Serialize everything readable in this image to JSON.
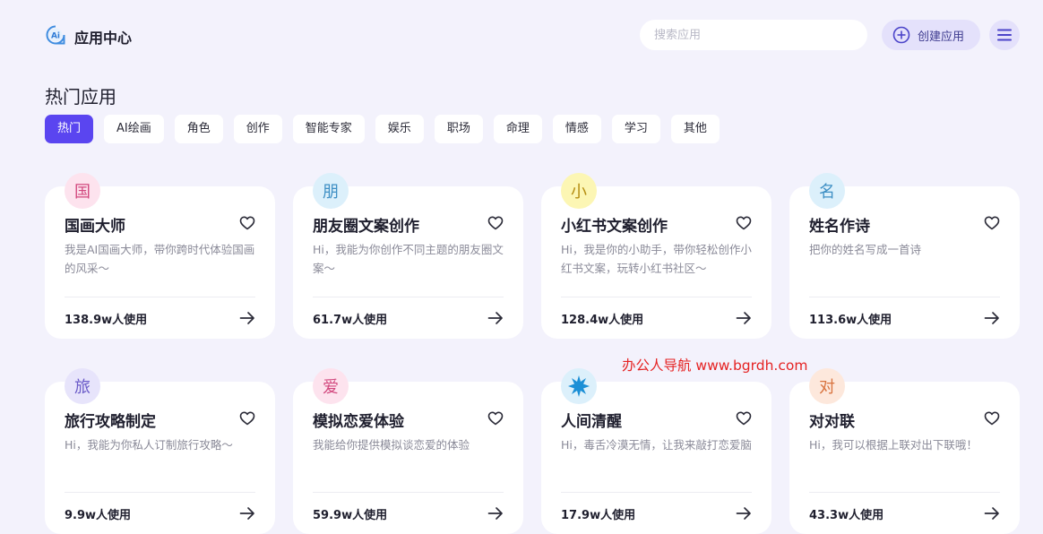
{
  "header": {
    "title": "应用中心",
    "logo_text": "Ai",
    "search_placeholder": "搜索应用",
    "create_label": "创建应用"
  },
  "section_title": "热门应用",
  "tabs": [
    {
      "label": "热门",
      "active": true
    },
    {
      "label": "AI绘画"
    },
    {
      "label": "角色"
    },
    {
      "label": "创作"
    },
    {
      "label": "智能专家"
    },
    {
      "label": "娱乐"
    },
    {
      "label": "职场"
    },
    {
      "label": "命理"
    },
    {
      "label": "情感"
    },
    {
      "label": "学习"
    },
    {
      "label": "其他"
    }
  ],
  "cards": [
    {
      "badge": "国",
      "badge_bg": "#fde3ee",
      "badge_color": "#d2487e",
      "title": "国画大师",
      "desc": "我是AI国画大师，带你跨时代体验国画的风采～",
      "usage": "138.9w人使用"
    },
    {
      "badge": "朋",
      "badge_bg": "#dcf0fb",
      "badge_color": "#3e8fc4",
      "title": "朋友圈文案创作",
      "desc": "Hi，我能为你创作不同主题的朋友圈文案～",
      "usage": "61.7w人使用"
    },
    {
      "badge": "小",
      "badge_bg": "#fcf6b4",
      "badge_color": "#b58d10",
      "title": "小红书文案创作",
      "desc": "Hi，我是你的小助手，带你轻松创作小红书文案，玩转小红书社区～",
      "usage": "128.4w人使用"
    },
    {
      "badge": "名",
      "badge_bg": "#dcf0fb",
      "badge_color": "#3e8fc4",
      "title": "姓名作诗",
      "desc": "把你的姓名写成一首诗",
      "usage": "113.6w人使用"
    },
    {
      "badge": "旅",
      "badge_bg": "#e7e4fb",
      "badge_color": "#6a5ac8",
      "title": "旅行攻略制定",
      "desc": "Hi，我能为你私人订制旅行攻略～",
      "usage": "9.9w人使用"
    },
    {
      "badge": "爱",
      "badge_bg": "#fde3ee",
      "badge_color": "#d2487e",
      "title": "模拟恋爱体验",
      "desc": "我能给你提供模拟谈恋爱的体验",
      "usage": "59.9w人使用"
    },
    {
      "badge": "",
      "badge_bg": "#dcf0fb",
      "badge_color": "#1b8fd6",
      "title": "人间清醒",
      "desc": "Hi，毒舌冷漠无情，让我来敲打恋爱脑",
      "usage": "17.9w人使用"
    },
    {
      "badge": "对",
      "badge_bg": "#fde8dc",
      "badge_color": "#d8733e",
      "title": "对对联",
      "desc": "Hi，我可以根据上联对出下联哦！",
      "usage": "43.3w人使用"
    }
  ],
  "watermark": "办公人导航 www.bgrdh.com"
}
